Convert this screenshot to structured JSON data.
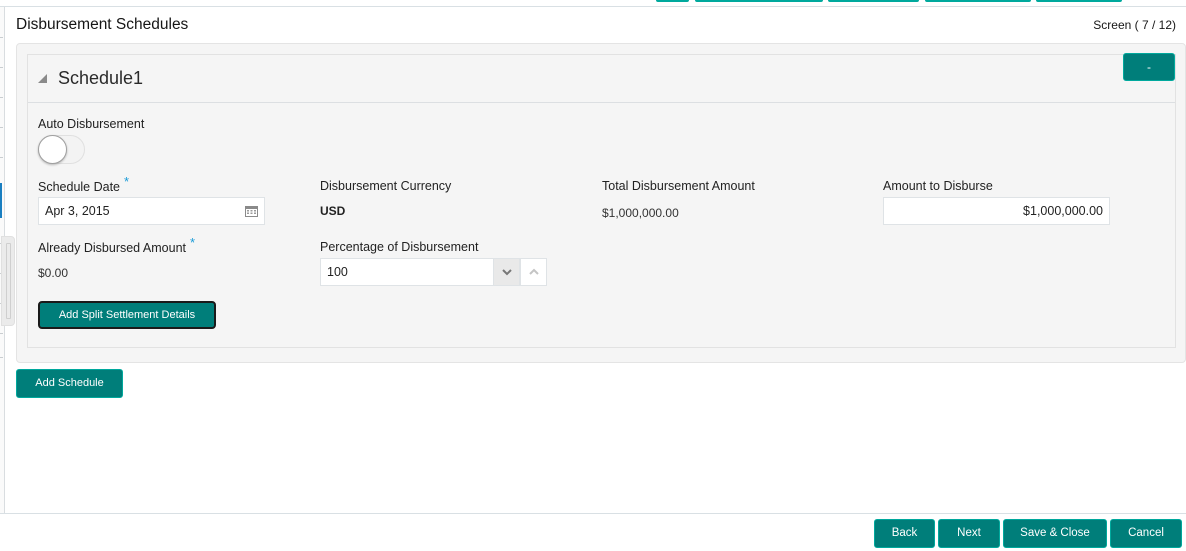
{
  "page": {
    "title": "Disbursement Schedules",
    "screen_counter": "Screen ( 7 / 12)"
  },
  "schedule": {
    "title": "Schedule1",
    "remove_label": "-",
    "auto_disbursement": {
      "label": "Auto Disbursement",
      "enabled": false
    },
    "schedule_date": {
      "label": "Schedule Date",
      "required_mark": "*",
      "value": "Apr 3, 2015",
      "icon": "calendar-icon"
    },
    "disbursement_currency": {
      "label": "Disbursement Currency",
      "value": "USD"
    },
    "total_disbursement_amount": {
      "label": "Total Disbursement Amount",
      "value": "$1,000,000.00"
    },
    "amount_to_disburse": {
      "label": "Amount to Disburse",
      "value": "$1,000,000.00"
    },
    "already_disbursed_amount": {
      "label": "Already Disbursed Amount",
      "required_mark": "*",
      "value": "$0.00"
    },
    "percentage_of_disbursement": {
      "label": "Percentage of Disbursement",
      "value": "100",
      "decrement_icon": "chevron-down-icon",
      "increment_icon": "chevron-up-icon"
    },
    "split_settlement_label": "Add Split Settlement Details"
  },
  "actions": {
    "add_schedule": "Add Schedule"
  },
  "footer": {
    "back": "Back",
    "next": "Next",
    "save_close": "Save & Close",
    "cancel": "Cancel"
  },
  "colors": {
    "primary_button": "#007e7a",
    "button_border": "#00a99d",
    "required_mark": "#1a9bd7",
    "active_rail": "#1a7fc1"
  }
}
